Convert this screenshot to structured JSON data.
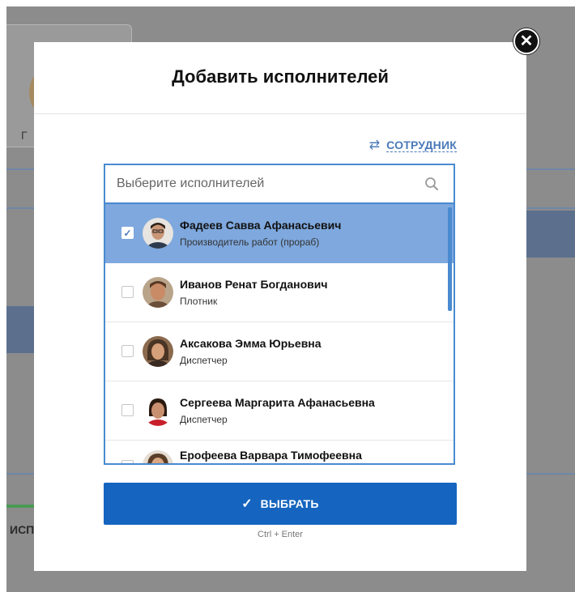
{
  "background": {
    "partial_text": "ИСП",
    "card_text": "Г"
  },
  "modal": {
    "title": "Добавить исполнителей",
    "close_icon": "close-icon",
    "mode_toggle": {
      "label": "СОТРУДНИК",
      "icon": "swap-arrows-icon"
    },
    "search": {
      "placeholder": "Выберите исполнителей",
      "value": "",
      "icon": "search-icon"
    },
    "executors": [
      {
        "name": "Фадеев Савва Афанасьевич",
        "role": "Производитель работ (прораб)",
        "checked": true
      },
      {
        "name": "Иванов Ренат Богданович",
        "role": "Плотник",
        "checked": false
      },
      {
        "name": "Аксакова Эмма Юрьевна",
        "role": "Диспетчер",
        "checked": false
      },
      {
        "name": "Сергеева Маргарита Афанасьевна",
        "role": "Диспетчер",
        "checked": false
      },
      {
        "name": "Ерофеева Варвара Тимофеевна",
        "role": "",
        "checked": false
      }
    ],
    "submit": {
      "label": "ВЫБРАТЬ",
      "icon": "check-icon"
    },
    "hint": "Ctrl + Enter"
  },
  "colors": {
    "accent": "#1565c0",
    "selected_row": "#7ea8de",
    "border": "#4a8ad1"
  }
}
